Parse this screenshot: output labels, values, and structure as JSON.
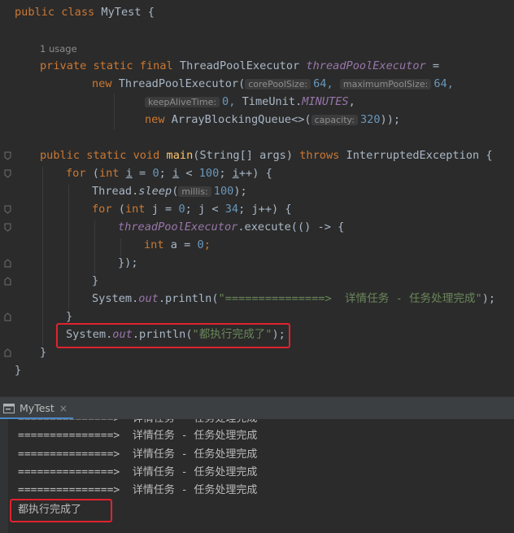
{
  "editor": {
    "line1": {
      "kw1": "public",
      "kw2": "class",
      "name": "MyTest",
      "brace": "{"
    },
    "usage": "1 usage",
    "field": {
      "kw1": "private",
      "kw2": "static",
      "kw3": "final",
      "type": "ThreadPoolExecutor",
      "name": "threadPoolExecutor",
      "eq": "="
    },
    "ctor": {
      "kw": "new",
      "type": "ThreadPoolExecutor(",
      "hint1": "corePoolSize:",
      "val1": "64,",
      "hint2": "maximumPoolSize:",
      "val2": "64,"
    },
    "ctor2": {
      "hint": "keepAliveTime:",
      "val": "0,",
      "unit_a": "TimeUnit.",
      "unit_b": "MINUTES",
      "comma": ","
    },
    "ctor3": {
      "kw": "new",
      "type": "ArrayBlockingQueue<>(",
      "hint": "capacity:",
      "val": "320",
      "close": "));"
    },
    "main": {
      "kw1": "public",
      "kw2": "static",
      "kw3": "void",
      "name": "main",
      "params": "(String[] args)",
      "kw4": "throws",
      "exc": "InterruptedException {"
    },
    "for1": {
      "kw": "for",
      "p1": "(",
      "kw2": "int",
      "var": "i",
      "p2": " = ",
      "n0": "0",
      "p3": "; ",
      "var2": "i",
      "p4": " < ",
      "n1": "100",
      "p5": "; ",
      "var3": "i",
      "p6": "++) {"
    },
    "sleep": {
      "a": "Thread.",
      "m": "sleep",
      "b": "(",
      "hint": "millis:",
      "val": "100",
      "c": ");"
    },
    "for2": {
      "kw": "for",
      "p1": "(",
      "kw2": "int",
      "rest1": "j = ",
      "n0": "0",
      "rest2": "; j < ",
      "n1": "34",
      "rest3": "; j++) {"
    },
    "exec": {
      "field": "threadPoolExecutor",
      "rest": ".execute(() -> {"
    },
    "inner": {
      "kw": "int",
      "var": "a",
      "eq": " = ",
      "n": "0",
      "semi": ";"
    },
    "close_lambda": "});",
    "close_brace": "}",
    "println1": {
      "a": "System.",
      "out": "out",
      "b": ".println(",
      "str": "\"===============>  详情任务 - 任务处理完成\"",
      "c": ");"
    },
    "println2": {
      "a": "System.",
      "out": "out",
      "b": ".println(",
      "str": "\"都执行完成了\"",
      "c": ");"
    }
  },
  "toolwindow": {
    "tab_label": "MyTest",
    "close": "×"
  },
  "console": {
    "lines": [
      "===============>  详情任务 - 任务处理完成",
      "===============>  详情任务 - 任务处理完成",
      "===============>  详情任务 - 任务处理完成",
      "===============>  详情任务 - 任务处理完成",
      "===============>  详情任务 - 任务处理完成"
    ],
    "final_line": "都执行完成了"
  },
  "colors": {
    "keyword": "#cc7832",
    "method": "#ffc66d",
    "number": "#6897bb",
    "string": "#6a8759",
    "field": "#9876aa",
    "highlight": "#e0232e"
  }
}
